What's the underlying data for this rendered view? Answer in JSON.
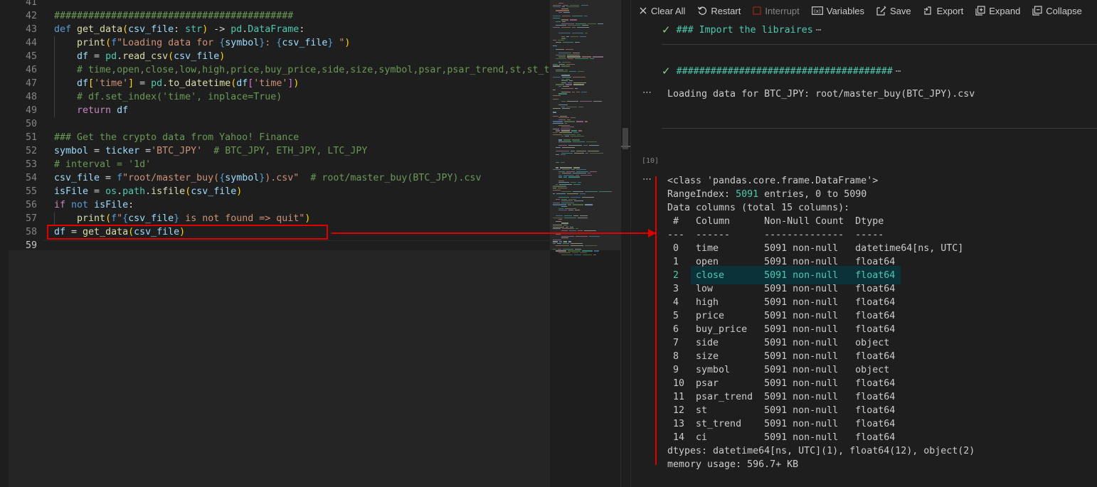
{
  "editor": {
    "lines": [
      {
        "n": "41",
        "tokens": []
      },
      {
        "n": "42",
        "tokens": [
          {
            "t": "##########################################",
            "c": "com"
          }
        ]
      },
      {
        "n": "43",
        "tokens": [
          {
            "t": "def ",
            "c": "kw"
          },
          {
            "t": "get_data",
            "c": "fn"
          },
          {
            "t": "(",
            "c": "br1"
          },
          {
            "t": "csv_file",
            "c": "var"
          },
          {
            "t": ": ",
            "c": "txt"
          },
          {
            "t": "str",
            "c": "type"
          },
          {
            "t": ")",
            "c": "br1"
          },
          {
            "t": " -> ",
            "c": "txt"
          },
          {
            "t": "pd",
            "c": "type"
          },
          {
            "t": ".",
            "c": "txt"
          },
          {
            "t": "DataFrame",
            "c": "type"
          },
          {
            "t": ":",
            "c": "txt"
          }
        ]
      },
      {
        "n": "44",
        "tokens": [
          {
            "t": "    ",
            "c": "txt"
          },
          {
            "t": "print",
            "c": "fn"
          },
          {
            "t": "(",
            "c": "br1"
          },
          {
            "t": "f",
            "c": "kw"
          },
          {
            "t": "\"Loading data for ",
            "c": "str"
          },
          {
            "t": "{",
            "c": "kw"
          },
          {
            "t": "symbol",
            "c": "var"
          },
          {
            "t": "}",
            "c": "kw"
          },
          {
            "t": ": ",
            "c": "str"
          },
          {
            "t": "{",
            "c": "kw"
          },
          {
            "t": "csv_file",
            "c": "var"
          },
          {
            "t": "}",
            "c": "kw"
          },
          {
            "t": " \"",
            "c": "str"
          },
          {
            "t": ")",
            "c": "br1"
          }
        ]
      },
      {
        "n": "45",
        "tokens": [
          {
            "t": "    ",
            "c": "txt"
          },
          {
            "t": "df",
            "c": "var"
          },
          {
            "t": " = ",
            "c": "txt"
          },
          {
            "t": "pd",
            "c": "type"
          },
          {
            "t": ".",
            "c": "txt"
          },
          {
            "t": "read_csv",
            "c": "fn"
          },
          {
            "t": "(",
            "c": "br1"
          },
          {
            "t": "csv_file",
            "c": "var"
          },
          {
            "t": ")",
            "c": "br1"
          }
        ]
      },
      {
        "n": "46",
        "tokens": [
          {
            "t": "    ",
            "c": "txt"
          },
          {
            "t": "# time,open,close,low,high,price,buy_price,side,size,symbol,psar,psar_trend,st,st_trend",
            "c": "com"
          }
        ]
      },
      {
        "n": "47",
        "tokens": [
          {
            "t": "    ",
            "c": "txt"
          },
          {
            "t": "df",
            "c": "var"
          },
          {
            "t": "[",
            "c": "br1"
          },
          {
            "t": "'time'",
            "c": "str"
          },
          {
            "t": "]",
            "c": "br1"
          },
          {
            "t": " = ",
            "c": "txt"
          },
          {
            "t": "pd",
            "c": "type"
          },
          {
            "t": ".",
            "c": "txt"
          },
          {
            "t": "to_datetime",
            "c": "fn"
          },
          {
            "t": "(",
            "c": "br1"
          },
          {
            "t": "df",
            "c": "var"
          },
          {
            "t": "[",
            "c": "br2"
          },
          {
            "t": "'time'",
            "c": "str"
          },
          {
            "t": "]",
            "c": "br2"
          },
          {
            "t": ")",
            "c": "br1"
          }
        ]
      },
      {
        "n": "48",
        "tokens": [
          {
            "t": "    ",
            "c": "txt"
          },
          {
            "t": "# df.set_index('time', inplace=True)",
            "c": "com"
          }
        ]
      },
      {
        "n": "49",
        "tokens": [
          {
            "t": "    ",
            "c": "txt"
          },
          {
            "t": "return ",
            "c": "ctl"
          },
          {
            "t": "df",
            "c": "var"
          }
        ]
      },
      {
        "n": "50",
        "tokens": []
      },
      {
        "n": "51",
        "tokens": [
          {
            "t": "### Get the crypto data from Yahoo! Finance",
            "c": "com"
          }
        ]
      },
      {
        "n": "52",
        "tokens": [
          {
            "t": "symbol",
            "c": "var"
          },
          {
            "t": " = ",
            "c": "txt"
          },
          {
            "t": "ticker",
            "c": "var"
          },
          {
            "t": " =",
            "c": "txt"
          },
          {
            "t": "'BTC_JPY'",
            "c": "str"
          },
          {
            "t": "  ",
            "c": "txt"
          },
          {
            "t": "# BTC_JPY, ETH_JPY, LTC_JPY",
            "c": "com"
          }
        ]
      },
      {
        "n": "53",
        "tokens": [
          {
            "t": "# interval = '1d'",
            "c": "com"
          }
        ]
      },
      {
        "n": "54",
        "tokens": [
          {
            "t": "csv_file",
            "c": "var"
          },
          {
            "t": " = ",
            "c": "txt"
          },
          {
            "t": "f",
            "c": "kw"
          },
          {
            "t": "\"root/master_buy(",
            "c": "str"
          },
          {
            "t": "{",
            "c": "kw"
          },
          {
            "t": "symbol",
            "c": "var"
          },
          {
            "t": "}",
            "c": "kw"
          },
          {
            "t": ").csv\"",
            "c": "str"
          },
          {
            "t": "  ",
            "c": "txt"
          },
          {
            "t": "# root/master_buy(BTC_JPY).csv",
            "c": "com"
          }
        ]
      },
      {
        "n": "55",
        "tokens": [
          {
            "t": "isFile",
            "c": "var"
          },
          {
            "t": " = ",
            "c": "txt"
          },
          {
            "t": "os",
            "c": "type"
          },
          {
            "t": ".",
            "c": "txt"
          },
          {
            "t": "path",
            "c": "type"
          },
          {
            "t": ".",
            "c": "txt"
          },
          {
            "t": "isfile",
            "c": "fn"
          },
          {
            "t": "(",
            "c": "br1"
          },
          {
            "t": "csv_file",
            "c": "var"
          },
          {
            "t": ")",
            "c": "br1"
          }
        ]
      },
      {
        "n": "56",
        "tokens": [
          {
            "t": "if ",
            "c": "ctl"
          },
          {
            "t": "not ",
            "c": "kw"
          },
          {
            "t": "isFile",
            "c": "var"
          },
          {
            "t": ":",
            "c": "txt"
          }
        ]
      },
      {
        "n": "57",
        "tokens": [
          {
            "t": "    ",
            "c": "txt"
          },
          {
            "t": "print",
            "c": "fn"
          },
          {
            "t": "(",
            "c": "br1"
          },
          {
            "t": "f",
            "c": "kw"
          },
          {
            "t": "\"",
            "c": "str"
          },
          {
            "t": "{",
            "c": "kw"
          },
          {
            "t": "csv_file",
            "c": "var"
          },
          {
            "t": "}",
            "c": "kw"
          },
          {
            "t": " is not found => quit\"",
            "c": "str"
          },
          {
            "t": ")",
            "c": "br1"
          }
        ]
      },
      {
        "n": "58",
        "tokens": [
          {
            "t": "df",
            "c": "var"
          },
          {
            "t": " = ",
            "c": "txt"
          },
          {
            "t": "get_data",
            "c": "fn"
          },
          {
            "t": "(",
            "c": "br1"
          },
          {
            "t": "csv_file",
            "c": "var"
          },
          {
            "t": ")",
            "c": "br1"
          }
        ]
      },
      {
        "n": "59",
        "tokens": []
      }
    ],
    "active_line": "59"
  },
  "toolbar": {
    "items": [
      {
        "label": "Clear All",
        "icon": "close-icon",
        "disabled": false
      },
      {
        "label": "Restart",
        "icon": "restart-icon",
        "disabled": false
      },
      {
        "label": "Interrupt",
        "icon": "stop-icon",
        "disabled": true
      },
      {
        "label": "Variables",
        "icon": "variables-icon",
        "disabled": false
      },
      {
        "label": "Save",
        "icon": "save-icon",
        "disabled": false
      },
      {
        "label": "Export",
        "icon": "export-icon",
        "disabled": false
      },
      {
        "label": "Expand",
        "icon": "expand-icon",
        "disabled": false
      },
      {
        "label": "Collapse",
        "icon": "collapse-icon",
        "disabled": false
      }
    ]
  },
  "cells": {
    "md1": {
      "text": "### Import the libraires",
      "ellipsis": "⋯"
    },
    "md2": {
      "text": "######################################",
      "ellipsis": "⋯"
    },
    "more_label": "⋯",
    "output1": "Loading data for BTC_JPY: root/master_buy(BTC_JPY).csv",
    "exec_count": "[10]",
    "info": {
      "class_line": "<class 'pandas.core.frame.DataFrame'>",
      "range_pre": "RangeIndex: ",
      "range_num": "5091",
      "range_post": " entries, 0 to 5090",
      "data_columns": "Data columns (total 15 columns):",
      "header": " #   Column      Non-Null Count  Dtype",
      "divider": "---  ------      --------------  -----",
      "rows": [
        " 0   time        5091 non-null   datetime64[ns, UTC]",
        " 1   open        5091 non-null   float64",
        " 2   close       5091 non-null   float64",
        " 3   low         5091 non-null   float64",
        " 4   high        5091 non-null   float64",
        " 5   price       5091 non-null   float64",
        " 6   buy_price   5091 non-null   float64",
        " 7   side        5091 non-null   object",
        " 8   size        5091 non-null   float64",
        " 9   symbol      5091 non-null   object",
        " 10  psar        5091 non-null   float64",
        " 11  psar_trend  5091 non-null   float64",
        " 12  st          5091 non-null   float64",
        " 13  st_trend    5091 non-null   float64",
        " 14  ci          5091 non-null   float64"
      ],
      "highlighted_row": 2,
      "dtypes": "dtypes: datetime64[ns, UTC](1), float64(12), object(2)",
      "memory": "memory usage: 596.7+ KB"
    }
  },
  "colors": {
    "annotation_red": "#e00000",
    "teal": "#4ec9b0",
    "check_green": "#89d185"
  }
}
